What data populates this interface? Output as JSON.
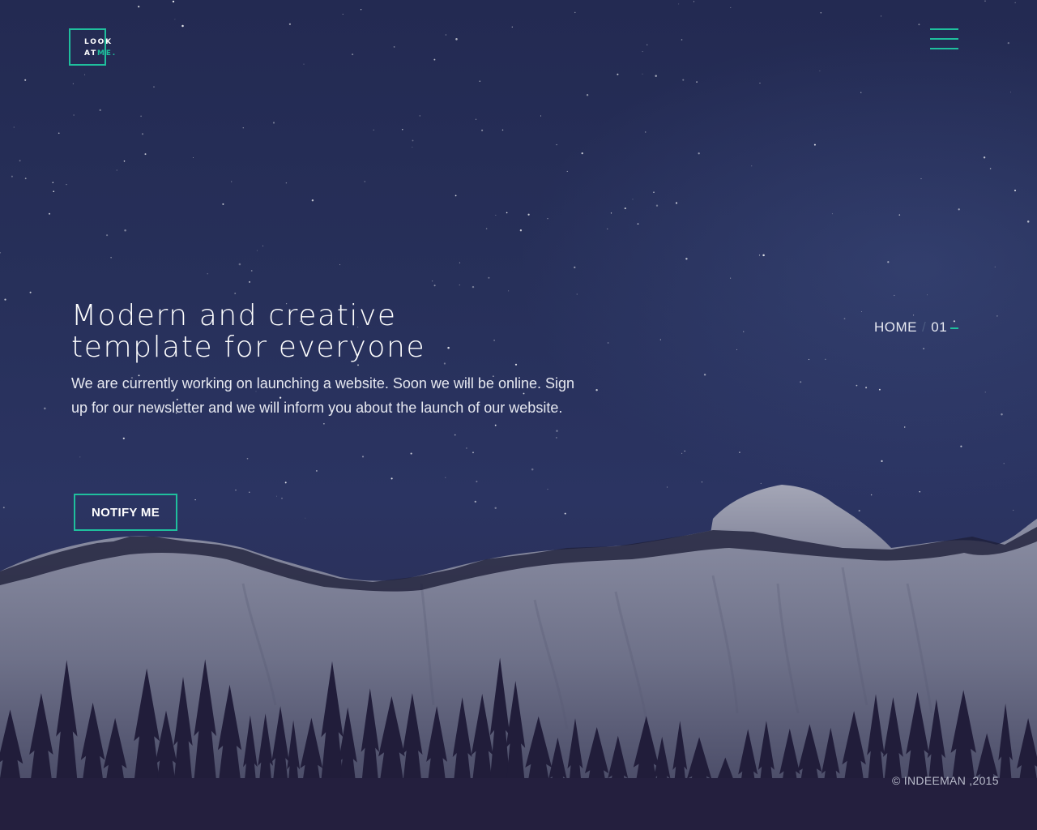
{
  "logo": {
    "line1": "LOOK",
    "line2_prefix": "AT",
    "line2_accent": "ME.",
    "accent_color": "#1fbf9d"
  },
  "header": {
    "menu_icon": "hamburger-menu-icon"
  },
  "hero": {
    "title_line1": "Modern and creative",
    "title_line2": "template for everyone",
    "description": "We are currently working on launching a website. Soon we will be online. Sign up for our newsletter and we will inform you about the launch of our website.",
    "button_label": "NOTIFY ME"
  },
  "breadcrumb": {
    "home": "HOME",
    "separator": "/",
    "page": "01"
  },
  "footer": {
    "copyright": "© INDEEMAN ,2015"
  },
  "colors": {
    "accent": "#1fbf9d",
    "sky": "#27305a"
  }
}
